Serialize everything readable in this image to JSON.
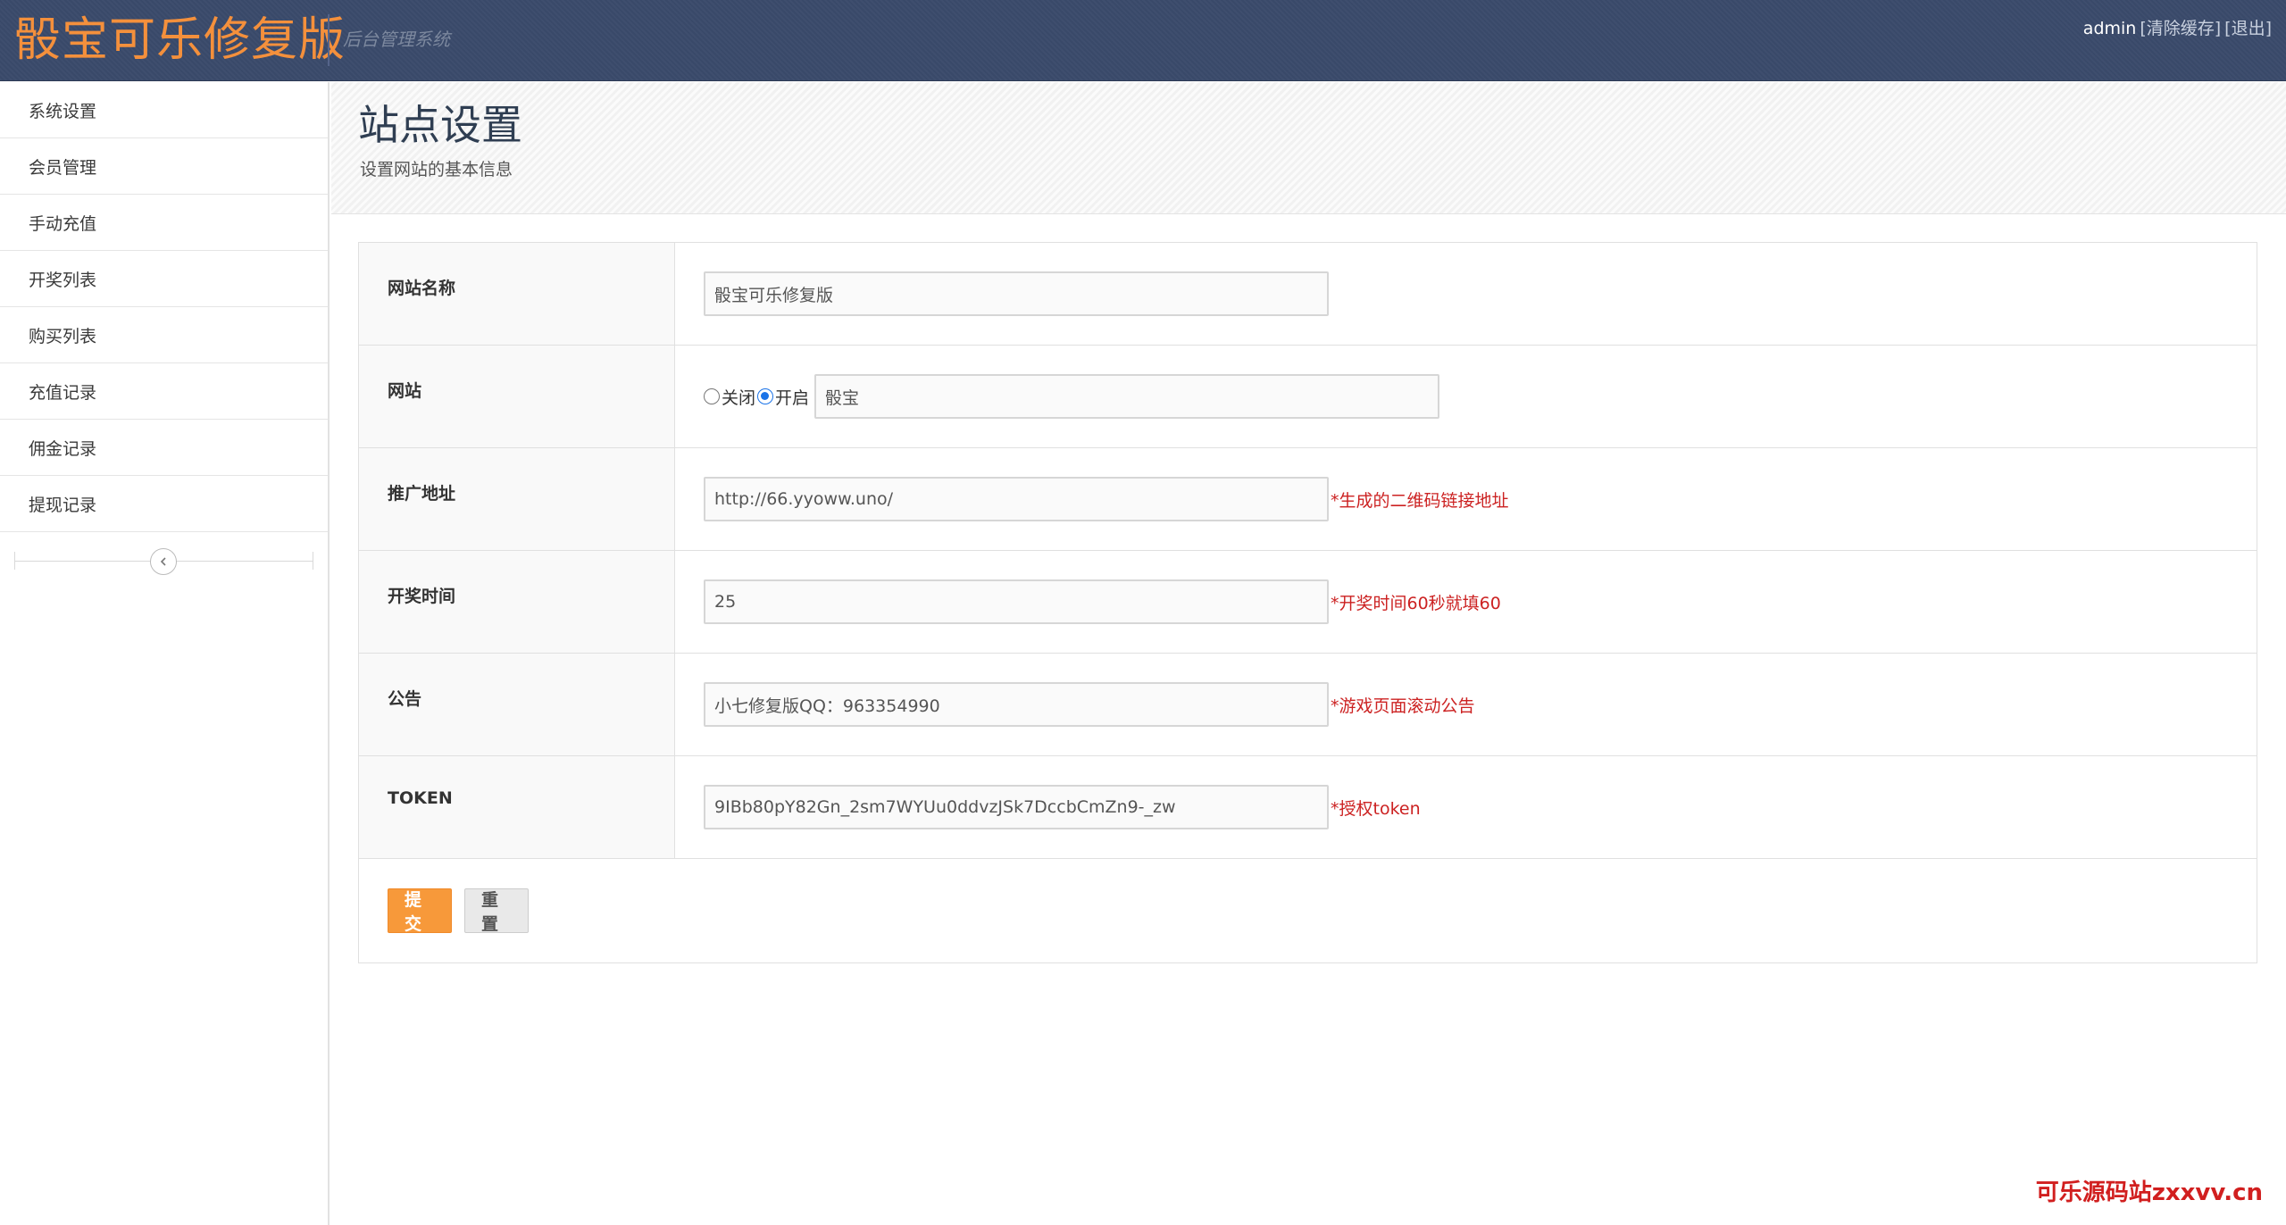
{
  "header": {
    "brand": "骰宝可乐修复版",
    "subtitle": "后台管理系统",
    "username": "admin",
    "clear_cache": "[清除缓存]",
    "logout": "[退出]"
  },
  "sidebar": {
    "items": [
      {
        "label": "系统设置"
      },
      {
        "label": "会员管理"
      },
      {
        "label": "手动充值"
      },
      {
        "label": "开奖列表"
      },
      {
        "label": "购买列表"
      },
      {
        "label": "充值记录"
      },
      {
        "label": "佣金记录"
      },
      {
        "label": "提现记录"
      }
    ],
    "collapse_icon": "chevron-left-icon"
  },
  "page": {
    "title": "站点设置",
    "subtitle": "设置网站的基本信息"
  },
  "form": {
    "site_name": {
      "label": "网站名称",
      "value": "骰宝可乐修复版"
    },
    "site": {
      "label": "网站",
      "option_off": "关闭",
      "option_on": "开启",
      "selected": "开启",
      "value": "骰宝"
    },
    "promo_url": {
      "label": "推广地址",
      "value": "http://66.yyoww.uno/",
      "hint": "*生成的二维码链接地址"
    },
    "draw_time": {
      "label": "开奖时间",
      "value": "25",
      "hint": "*开奖时间60秒就填60"
    },
    "notice": {
      "label": "公告",
      "value": "小七修复版QQ：963354990",
      "hint": "*游戏页面滚动公告"
    },
    "token": {
      "label": "TOKEN",
      "value": "9IBb80pY82Gn_2sm7WYUu0ddvzJSk7DccbCmZn9-_zw",
      "hint": "*授权token"
    },
    "submit_label": "提交",
    "reset_label": "重置"
  },
  "watermark": "可乐源码站zxxvv.cn",
  "colors": {
    "navbar": "#3a4a6b",
    "brand": "#f4903c",
    "submit": "#f7993a",
    "hint": "#cc2222"
  }
}
